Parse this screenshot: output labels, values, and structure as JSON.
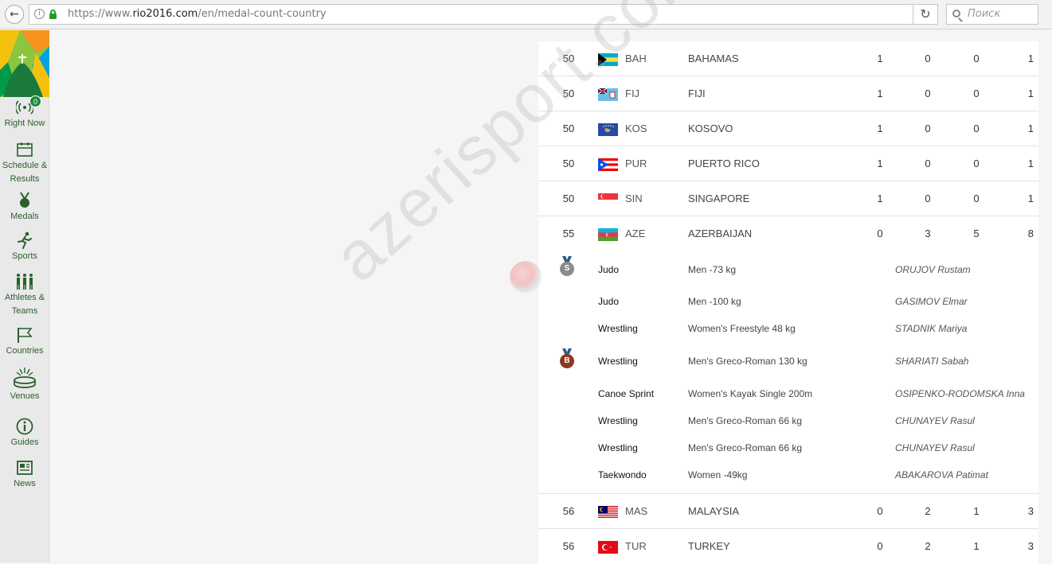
{
  "browser": {
    "url_prefix": "https://www.",
    "url_domain": "rio2016.com",
    "url_path": "/en/medal-count-country",
    "search_placeholder": "Поиск"
  },
  "sidebar": {
    "right_now_badge": "0",
    "items": [
      {
        "label": "Right Now"
      },
      {
        "label": "Schedule &\nResults"
      },
      {
        "label": "Medals"
      },
      {
        "label": "Sports"
      },
      {
        "label": "Athletes &\nTeams"
      },
      {
        "label": "Countries"
      },
      {
        "label": "Venues"
      },
      {
        "label": "Guides"
      },
      {
        "label": "News"
      }
    ]
  },
  "watermark": "azerisport.com",
  "countries": [
    {
      "rank": "50",
      "code": "BAH",
      "name": "BAHAMAS",
      "gold": "1",
      "silver": "0",
      "bronze": "0",
      "total": "1"
    },
    {
      "rank": "50",
      "code": "FIJ",
      "name": "FIJI",
      "gold": "1",
      "silver": "0",
      "bronze": "0",
      "total": "1"
    },
    {
      "rank": "50",
      "code": "KOS",
      "name": "KOSOVO",
      "gold": "1",
      "silver": "0",
      "bronze": "0",
      "total": "1"
    },
    {
      "rank": "50",
      "code": "PUR",
      "name": "PUERTO RICO",
      "gold": "1",
      "silver": "0",
      "bronze": "0",
      "total": "1"
    },
    {
      "rank": "50",
      "code": "SIN",
      "name": "SINGAPORE",
      "gold": "1",
      "silver": "0",
      "bronze": "0",
      "total": "1"
    },
    {
      "rank": "55",
      "code": "AZE",
      "name": "AZERBAIJAN",
      "gold": "0",
      "silver": "3",
      "bronze": "5",
      "total": "8"
    },
    {
      "rank": "56",
      "code": "MAS",
      "name": "MALAYSIA",
      "gold": "0",
      "silver": "2",
      "bronze": "1",
      "total": "3"
    },
    {
      "rank": "56",
      "code": "TUR",
      "name": "TURKEY",
      "gold": "0",
      "silver": "2",
      "bronze": "1",
      "total": "3"
    }
  ],
  "aze_medals": [
    {
      "medal": "S",
      "sport": "Judo",
      "event": "Men -73 kg",
      "athlete": "ORUJOV Rustam"
    },
    {
      "medal": "",
      "sport": "Judo",
      "event": "Men -100 kg",
      "athlete": "GASIMOV Elmar"
    },
    {
      "medal": "",
      "sport": "Wrestling",
      "event": "Women's Freestyle 48 kg",
      "athlete": "STADNIK Mariya"
    },
    {
      "medal": "B",
      "sport": "Wrestling",
      "event": "Men's Greco-Roman 130 kg",
      "athlete": "SHARIATI Sabah"
    },
    {
      "medal": "",
      "sport": "Canoe Sprint",
      "event": "Women's Kayak Single 200m",
      "athlete": "OSIPENKO-RODOMSKA Inna"
    },
    {
      "medal": "",
      "sport": "Wrestling",
      "event": "Men's Greco-Roman 66 kg",
      "athlete": "CHUNAYEV Rasul"
    },
    {
      "medal": "",
      "sport": "Wrestling",
      "event": "Men's Greco-Roman 66 kg",
      "athlete": "CHUNAYEV Rasul"
    },
    {
      "medal": "",
      "sport": "Taekwondo",
      "event": "Women -49kg",
      "athlete": "ABAKAROVA Patimat"
    }
  ],
  "colors": {
    "silver": "#8c8c8c",
    "bronze": "#8b3a1f",
    "ribbon": "#2e5a8f",
    "sidebar_green": "#2b5f2b"
  }
}
